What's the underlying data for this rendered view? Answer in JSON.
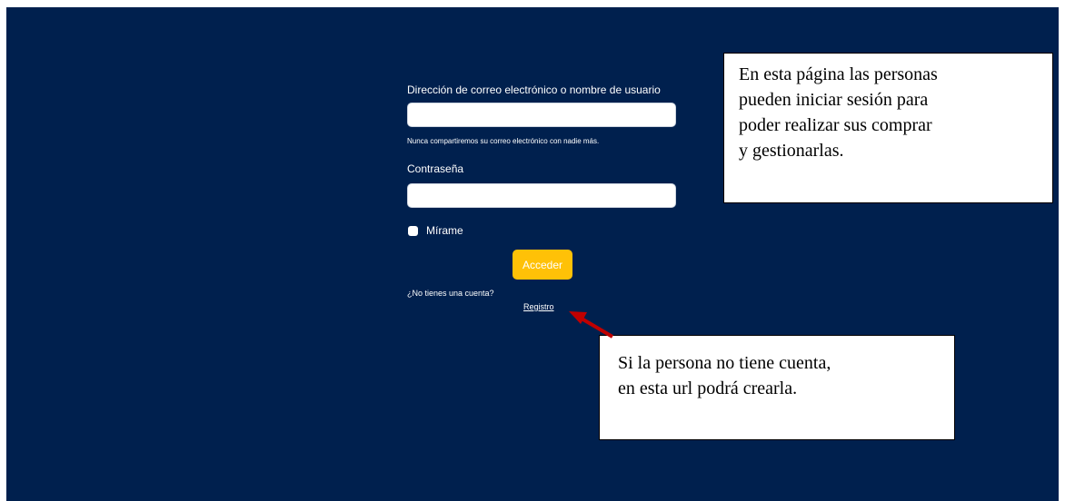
{
  "login_form": {
    "email_label": "Dirección de correo electrónico o nombre de usuario",
    "email_value": "",
    "email_help": "Nunca compartiremos su correo electrónico con nadie más.",
    "password_label": "Contraseña",
    "password_value": "",
    "remember_label": "Mírame",
    "remember_checked": false,
    "submit_label": "Acceder",
    "no_account_text": "¿No tienes una cuenta?",
    "register_link": "Registro"
  },
  "annotations": {
    "top_callout": [
      "En esta página las personas",
      "pueden iniciar sesión para",
      "poder realizar sus comprar",
      "y gestionarlas."
    ],
    "bottom_callout": [
      "Si la persona no tiene cuenta,",
      "en esta url podrá crearla."
    ],
    "arrow_color": "#c00000"
  },
  "colors": {
    "background": "#00204e",
    "button": "#ffc107",
    "text": "#ffffff"
  }
}
